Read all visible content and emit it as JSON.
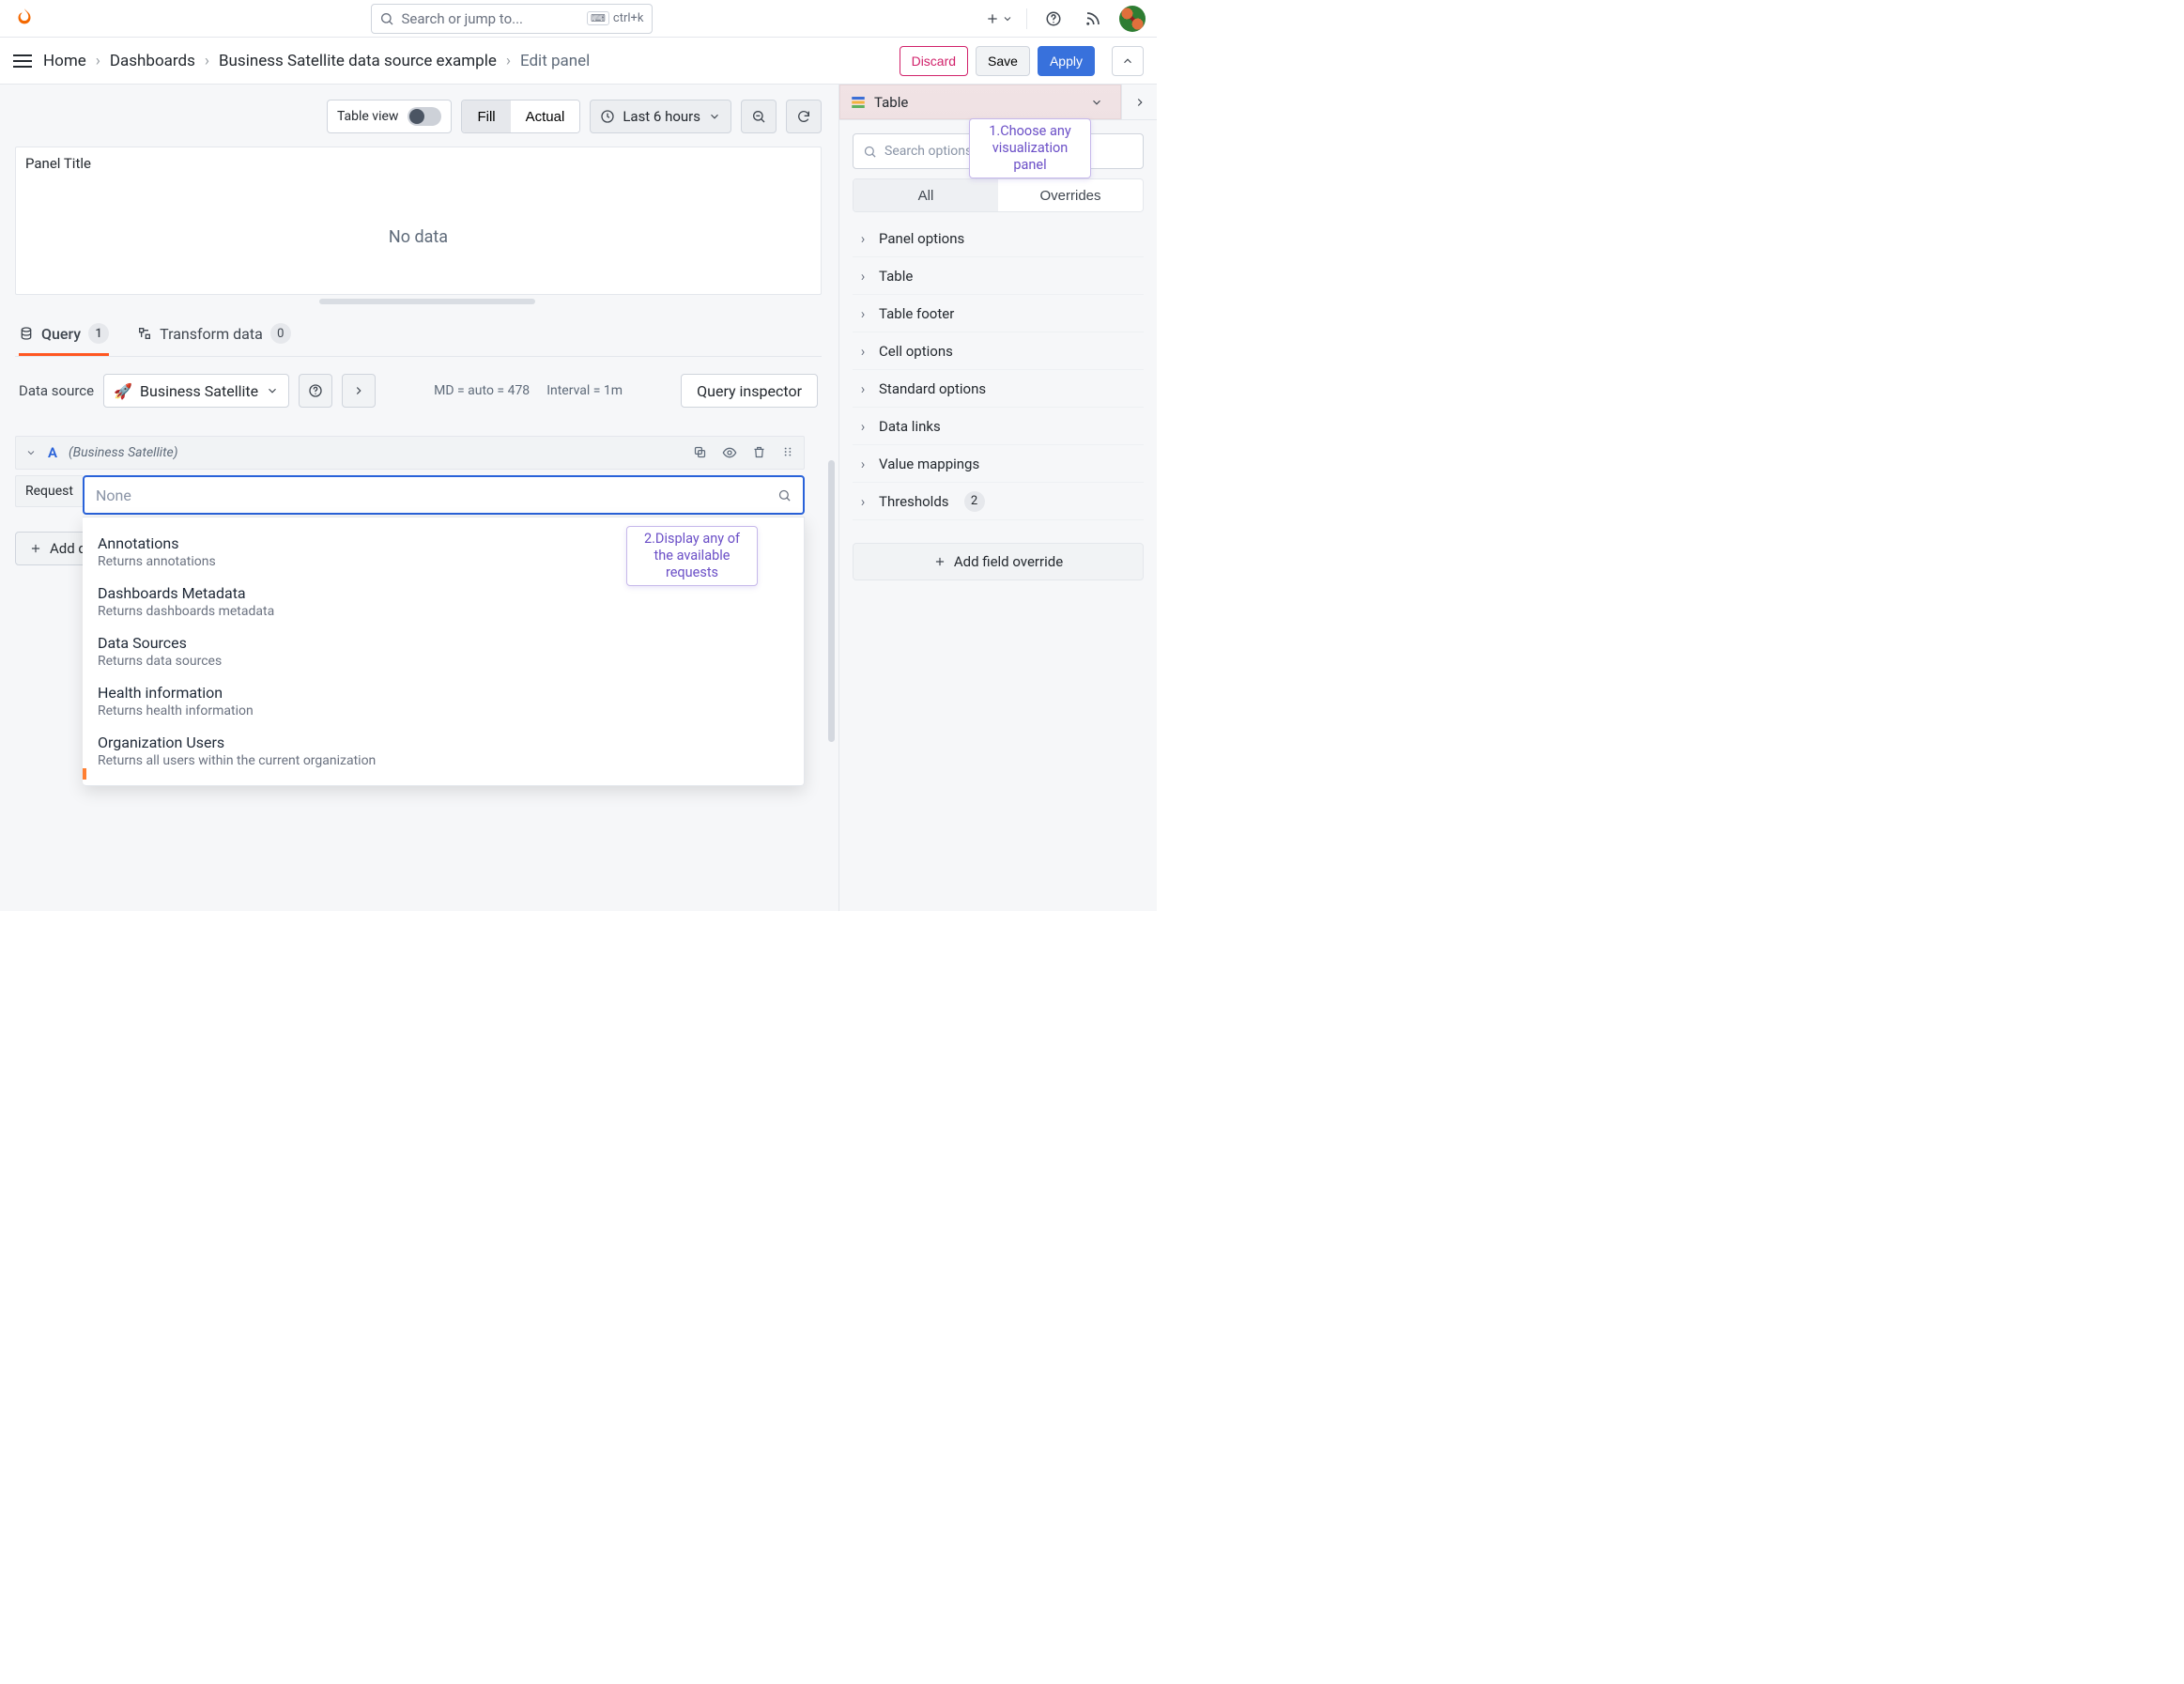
{
  "topbar": {
    "search_placeholder": "Search or jump to...",
    "kbd_hint": "ctrl+k"
  },
  "breadcrumbs": {
    "items": [
      "Home",
      "Dashboards",
      "Business Satellite data source example"
    ],
    "current": "Edit panel",
    "buttons": {
      "discard": "Discard",
      "save": "Save",
      "apply": "Apply"
    }
  },
  "toolbar": {
    "table_view": "Table view",
    "fill": "Fill",
    "actual": "Actual",
    "time_range": "Last 6 hours"
  },
  "panel": {
    "title": "Panel Title",
    "empty": "No data"
  },
  "tabs": {
    "query": {
      "label": "Query",
      "count": "1"
    },
    "transform": {
      "label": "Transform data",
      "count": "0"
    }
  },
  "query": {
    "ds_label": "Data source",
    "ds_name": "Business Satellite",
    "md_text": "MD = auto = 478",
    "interval_text": "Interval = 1m",
    "inspector": "Query inspector",
    "row": {
      "letter": "A",
      "ds_hint": "(Business Satellite)"
    },
    "request_label": "Request",
    "request_value": "None",
    "add_query": "Add query"
  },
  "dropdown": [
    {
      "title": "Annotations",
      "desc": "Returns annotations"
    },
    {
      "title": "Dashboards Metadata",
      "desc": "Returns dashboards metadata"
    },
    {
      "title": "Data Sources",
      "desc": "Returns data sources"
    },
    {
      "title": "Health information",
      "desc": "Returns health information"
    },
    {
      "title": "Organization Users",
      "desc": "Returns all users within the current organization"
    }
  ],
  "annotations": {
    "a1": "1.Choose any visualization panel",
    "a2": "2.Display any of the available requests"
  },
  "side": {
    "viz_name": "Table",
    "search_placeholder": "Search options",
    "tabs": {
      "all": "All",
      "overrides": "Overrides"
    },
    "options": [
      "Panel options",
      "Table",
      "Table footer",
      "Cell options",
      "Standard options",
      "Data links",
      "Value mappings"
    ],
    "thresholds": {
      "label": "Thresholds",
      "count": "2"
    },
    "add_override": "Add field override"
  }
}
